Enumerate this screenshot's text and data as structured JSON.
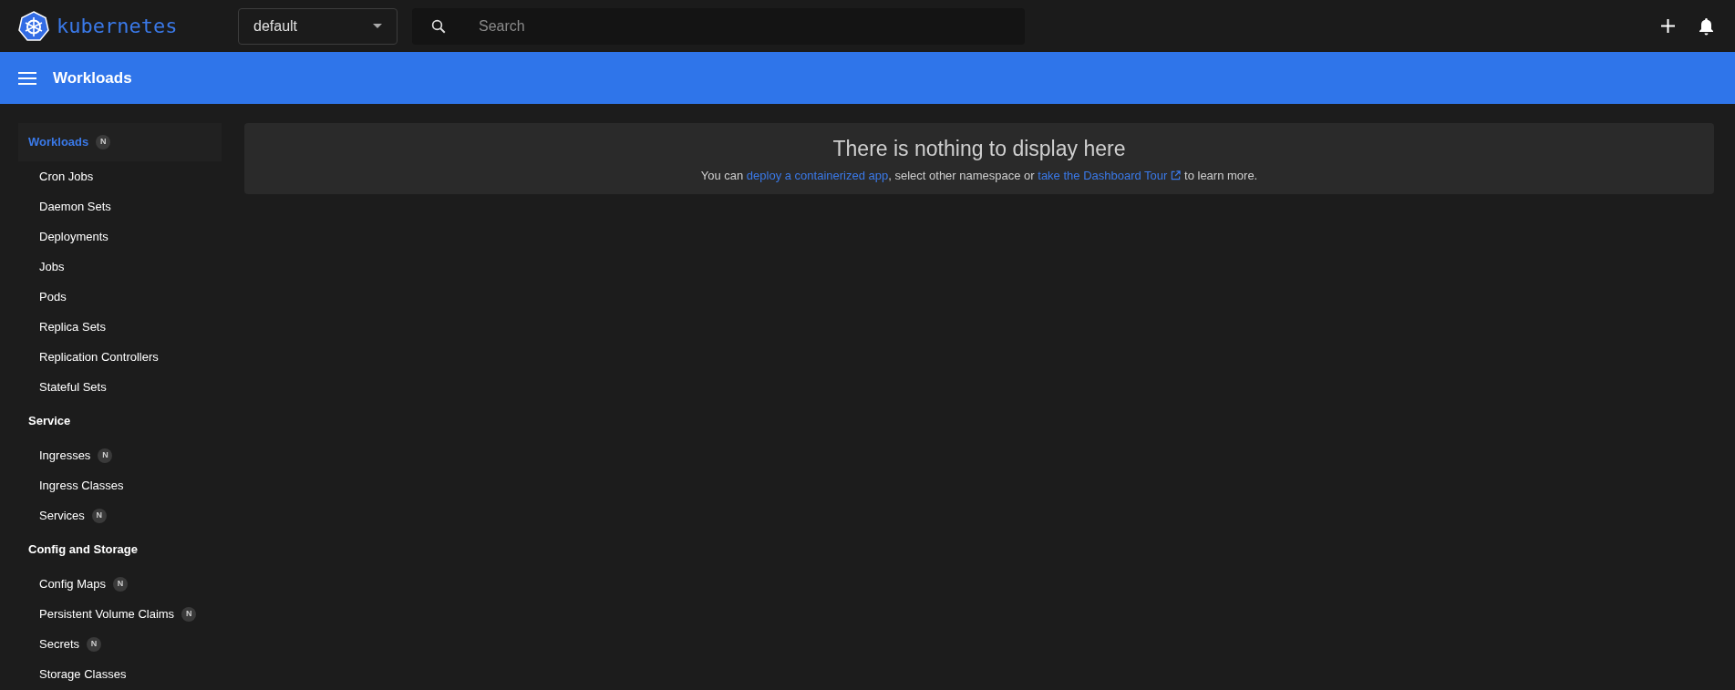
{
  "brand": {
    "name": "kubernetes"
  },
  "namespace": {
    "value": "default"
  },
  "search": {
    "placeholder": "Search"
  },
  "header": {
    "title": "Workloads"
  },
  "sidebar": {
    "sections": [
      {
        "label": "Workloads",
        "badge": "N",
        "selected": true,
        "items": [
          {
            "label": "Cron Jobs"
          },
          {
            "label": "Daemon Sets"
          },
          {
            "label": "Deployments"
          },
          {
            "label": "Jobs"
          },
          {
            "label": "Pods"
          },
          {
            "label": "Replica Sets"
          },
          {
            "label": "Replication Controllers"
          },
          {
            "label": "Stateful Sets"
          }
        ]
      },
      {
        "label": "Service",
        "selected": false,
        "items": [
          {
            "label": "Ingresses",
            "badge": "N"
          },
          {
            "label": "Ingress Classes"
          },
          {
            "label": "Services",
            "badge": "N"
          }
        ]
      },
      {
        "label": "Config and Storage",
        "selected": false,
        "items": [
          {
            "label": "Config Maps",
            "badge": "N"
          },
          {
            "label": "Persistent Volume Claims",
            "badge": "N"
          },
          {
            "label": "Secrets",
            "badge": "N"
          },
          {
            "label": "Storage Classes"
          }
        ]
      }
    ]
  },
  "empty_state": {
    "title": "There is nothing to display here",
    "parts": [
      {
        "kind": "text",
        "text": "You can "
      },
      {
        "kind": "link",
        "text": "deploy a containerized app"
      },
      {
        "kind": "text",
        "text": ", select other namespace or "
      },
      {
        "kind": "external_link",
        "text": "take the Dashboard Tour"
      },
      {
        "kind": "text",
        "text": " to learn more."
      }
    ]
  }
}
